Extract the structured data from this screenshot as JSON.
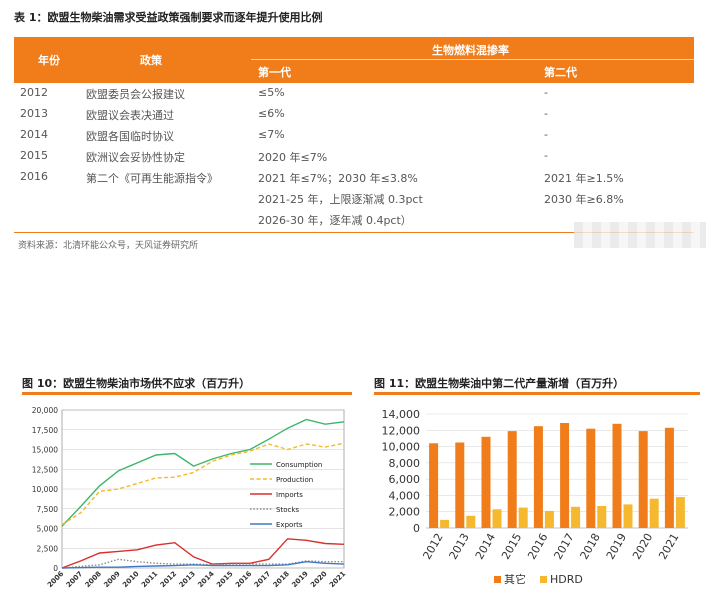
{
  "table1": {
    "title": "表 1：欧盟生物柴油需求受益政策强制要求而逐年提升使用比例",
    "headers": {
      "year": "年份",
      "policy": "政策",
      "group": "生物燃料混掺率",
      "gen1": "第一代",
      "gen2": "第二代"
    },
    "rows": [
      {
        "year": "2012",
        "policy": "欧盟委员会公报建议",
        "gen1": "≤5%",
        "gen2": "-"
      },
      {
        "year": "2013",
        "policy": "欧盟议会表决通过",
        "gen1": "≤6%",
        "gen2": "-"
      },
      {
        "year": "2014",
        "policy": "欧盟各国临时协议",
        "gen1": "≤7%",
        "gen2": "-"
      },
      {
        "year": "2015",
        "policy": "欧洲议会妥协性协定",
        "gen1": "2020 年≤7%",
        "gen2": "-"
      },
      {
        "year": "2016",
        "policy": "第二个《可再生能源指令》",
        "gen1": "2021 年≤7%；2030 年≤3.8%",
        "gen2": "2021 年≥1.5%"
      },
      {
        "year": "",
        "policy": "",
        "gen1": "2021-25 年，上限逐渐减 0.3pct",
        "gen2": "2030 年≥6.8%"
      },
      {
        "year": "",
        "policy": "",
        "gen1": "2026-30 年，逐年减 0.4pct）",
        "gen2": ""
      }
    ],
    "source": "资料来源：北清环能公众号，天风证券研究所"
  },
  "figure10": {
    "title": "图 10：欧盟生物柴油市场供不应求（百万升）"
  },
  "figure11": {
    "title": "图 11：欧盟生物柴油中第二代产量渐增（百万升）"
  },
  "chart_data": [
    {
      "type": "line",
      "x": [
        "2006",
        "2007",
        "2008",
        "2009",
        "2010",
        "2011",
        "2012",
        "2013",
        "2014",
        "2015",
        "2016",
        "2017",
        "2018",
        "2019",
        "2020",
        "2021"
      ],
      "ylim": [
        0,
        20000
      ],
      "yticks": [
        "0",
        "2,500",
        "5,000",
        "7,500",
        "10,000",
        "12,500",
        "15,000",
        "17,500",
        "20,000"
      ],
      "legend_position": "right",
      "series": [
        {
          "name": "Consumption",
          "color": "#3db56c",
          "dash": "solid",
          "values": [
            5300,
            7800,
            10400,
            12300,
            13300,
            14300,
            14500,
            12900,
            13800,
            14500,
            15000,
            16300,
            17700,
            18800,
            18200,
            18500
          ]
        },
        {
          "name": "Production",
          "color": "#f5b82e",
          "dash": "dashed",
          "values": [
            5500,
            7000,
            9700,
            10000,
            10700,
            11400,
            11500,
            12100,
            13500,
            14300,
            14800,
            15700,
            15000,
            15700,
            15300,
            15800
          ]
        },
        {
          "name": "Imports",
          "color": "#d9302c",
          "dash": "solid",
          "values": [
            0,
            900,
            1900,
            2100,
            2300,
            2900,
            3200,
            1400,
            500,
            600,
            600,
            1100,
            3700,
            3500,
            3100,
            3000
          ]
        },
        {
          "name": "Stocks",
          "color": "#8a8a8a",
          "dash": "dotted",
          "values": [
            0,
            200,
            400,
            1100,
            800,
            600,
            500,
            500,
            400,
            500,
            500,
            500,
            500,
            900,
            800,
            800
          ]
        },
        {
          "name": "Exports",
          "color": "#3f78c4",
          "dash": "solid",
          "values": [
            0,
            50,
            100,
            100,
            200,
            250,
            300,
            400,
            300,
            300,
            300,
            300,
            400,
            800,
            600,
            500
          ]
        }
      ]
    },
    {
      "type": "bar",
      "categories": [
        "2012",
        "2013",
        "2014",
        "2015",
        "2016",
        "2017",
        "2018",
        "2019",
        "2020",
        "2021"
      ],
      "ylim": [
        0,
        14000
      ],
      "yticks": [
        "0",
        "2,000",
        "4,000",
        "6,000",
        "8,000",
        "10,000",
        "12,000",
        "14,000"
      ],
      "legend_position": "bottom",
      "series": [
        {
          "name": "其它",
          "color": "#f07c1a",
          "values": [
            10400,
            10500,
            11200,
            11900,
            12500,
            12900,
            12200,
            12800,
            11900,
            12300
          ]
        },
        {
          "name": "HDRD",
          "color": "#f5b82e",
          "values": [
            1000,
            1500,
            2300,
            2500,
            2100,
            2600,
            2700,
            2900,
            3600,
            3800
          ]
        }
      ]
    }
  ]
}
